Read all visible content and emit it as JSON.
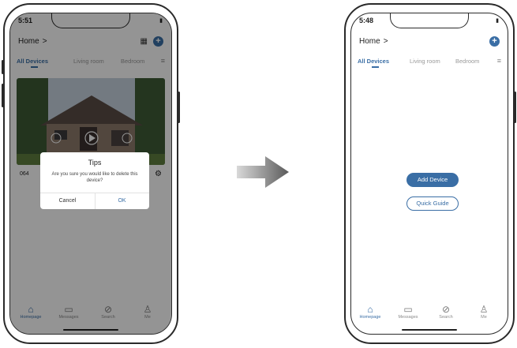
{
  "left_screen": {
    "time": "5:51",
    "home_label": "Home",
    "chevron": ">",
    "tabs": [
      {
        "label": "All Devices"
      },
      {
        "label": "Living room"
      },
      {
        "label": "Bedroom"
      }
    ],
    "device_name_partial": "064",
    "dialog": {
      "title": "Tips",
      "message": "Are you sure you would like to delete this device?",
      "cancel_label": "Cancel",
      "ok_label": "OK"
    },
    "nav": [
      {
        "label": "Homepage"
      },
      {
        "label": "Messages"
      },
      {
        "label": "Search"
      },
      {
        "label": "Me"
      }
    ]
  },
  "right_screen": {
    "time": "5:48",
    "home_label": "Home",
    "chevron": ">",
    "tabs": [
      {
        "label": "All Devices"
      },
      {
        "label": "Living room"
      },
      {
        "label": "Bedroom"
      }
    ],
    "add_device_label": "Add Device",
    "quick_guide_label": "Quick Guide",
    "nav": [
      {
        "label": "Homepage"
      },
      {
        "label": "Messages"
      },
      {
        "label": "Search"
      },
      {
        "label": "Me"
      }
    ]
  },
  "colors": {
    "accent": "#3a6ea5",
    "notification_dot": "#d62f2f"
  },
  "icons": [
    "grid-icon",
    "plus-icon",
    "menu-icon",
    "gear-icon",
    "home-icon",
    "message-icon",
    "search-icon",
    "person-icon",
    "arrow-right-icon"
  ]
}
